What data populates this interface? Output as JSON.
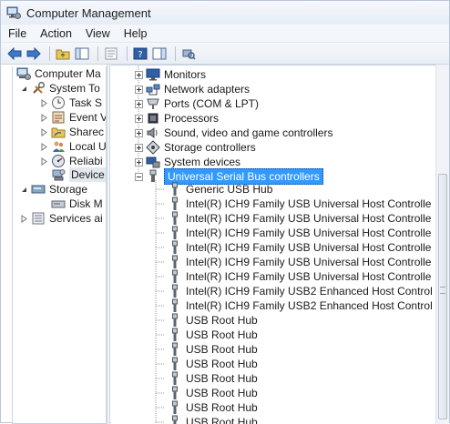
{
  "window": {
    "title": "Computer Management"
  },
  "menu": {
    "items": [
      "File",
      "Action",
      "View",
      "Help"
    ]
  },
  "left_tree": {
    "items": [
      {
        "label": "Computer Ma"
      },
      {
        "label": "System To"
      },
      {
        "label": "Task S"
      },
      {
        "label": "Event V"
      },
      {
        "label": "Sharec"
      },
      {
        "label": "Local U"
      },
      {
        "label": "Reliabi"
      },
      {
        "label": "Device"
      },
      {
        "label": "Storage"
      },
      {
        "label": "Disk M"
      },
      {
        "label": "Services ai"
      }
    ]
  },
  "right_tree": {
    "categories": [
      {
        "label": "Monitors"
      },
      {
        "label": "Network adapters"
      },
      {
        "label": "Ports (COM & LPT)"
      },
      {
        "label": "Processors"
      },
      {
        "label": "Sound, video and game controllers"
      },
      {
        "label": "Storage controllers"
      },
      {
        "label": "System devices"
      },
      {
        "label": "Universal Serial Bus controllers"
      }
    ],
    "usb_devices": [
      {
        "label": "Generic USB Hub"
      },
      {
        "label": "Intel(R) ICH9 Family USB Universal Host Controlle"
      },
      {
        "label": "Intel(R) ICH9 Family USB Universal Host Controlle"
      },
      {
        "label": "Intel(R) ICH9 Family USB Universal Host Controlle"
      },
      {
        "label": "Intel(R) ICH9 Family USB Universal Host Controlle"
      },
      {
        "label": "Intel(R) ICH9 Family USB Universal Host Controlle"
      },
      {
        "label": "Intel(R) ICH9 Family USB Universal Host Controlle"
      },
      {
        "label": "Intel(R) ICH9 Family USB2 Enhanced Host Control"
      },
      {
        "label": "Intel(R) ICH9 Family USB2 Enhanced Host Control"
      },
      {
        "label": "USB Root Hub"
      },
      {
        "label": "USB Root Hub"
      },
      {
        "label": "USB Root Hub"
      },
      {
        "label": "USB Root Hub"
      },
      {
        "label": "USB Root Hub"
      },
      {
        "label": "USB Root Hub"
      },
      {
        "label": "USB Root Hub"
      },
      {
        "label": "USB Root Hub"
      }
    ]
  },
  "colors": {
    "selection": "#3399ff",
    "window_border": "#b9c7d8"
  }
}
